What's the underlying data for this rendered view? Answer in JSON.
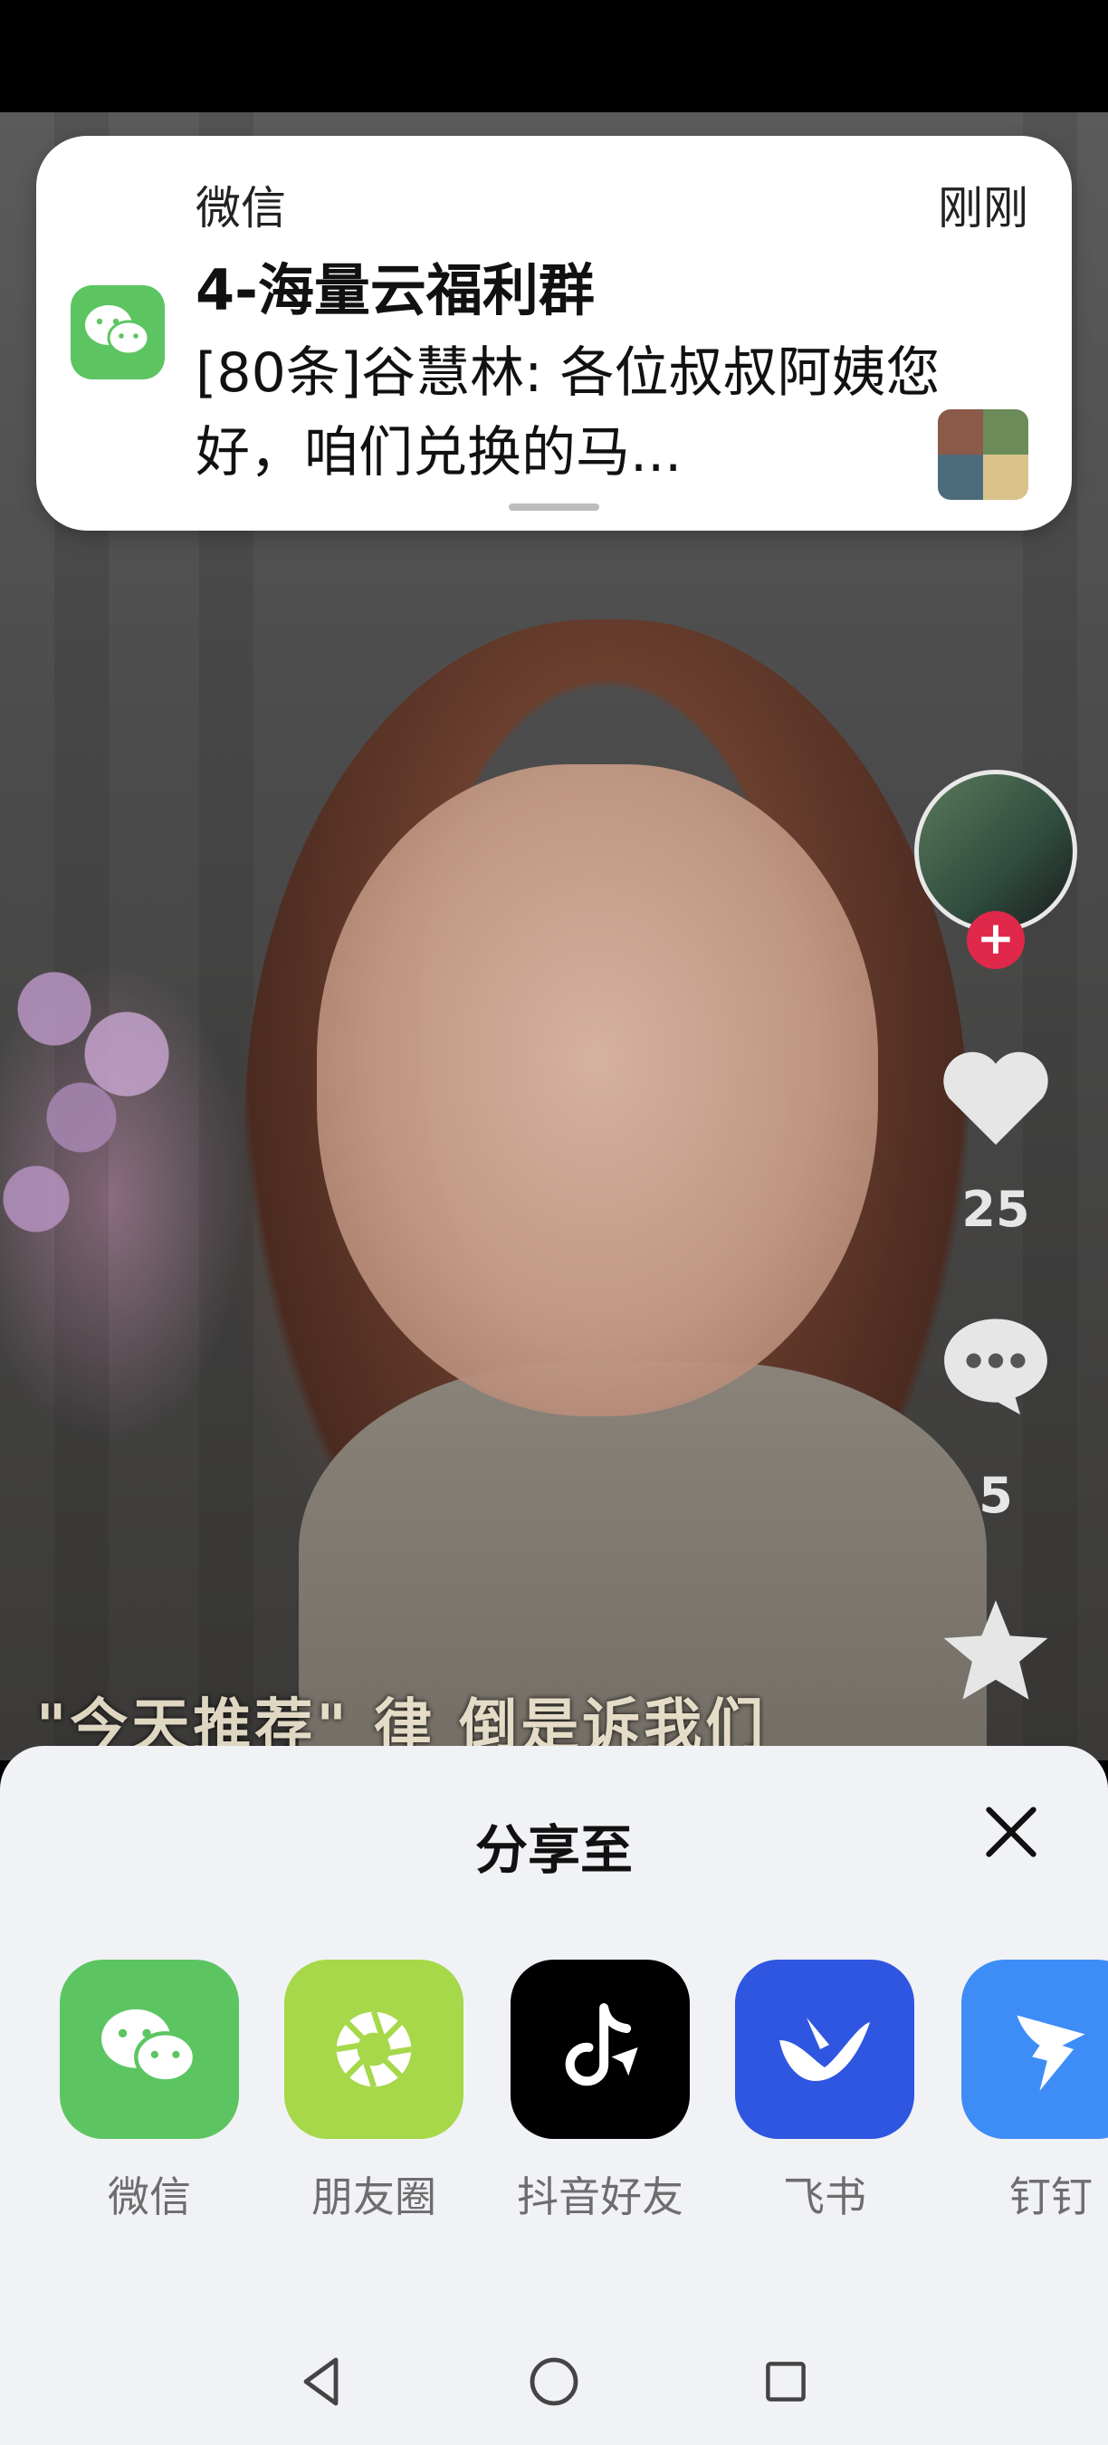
{
  "notification": {
    "app_name": "微信",
    "time": "刚刚",
    "title": "4-海量云福利群",
    "body": "[80条]谷慧林: 各位叔叔阿姨您好，咱们兑换的马...",
    "app_icon": "wechat-icon"
  },
  "video": {
    "subtitle": "\"今天推荐\" 律 倒是诉我们",
    "likes": "25",
    "comments": "5",
    "icons": [
      "avatar",
      "heart-icon",
      "comment-icon",
      "star-icon"
    ]
  },
  "share_sheet": {
    "title": "分享至",
    "close_icon": "close-icon",
    "targets": [
      {
        "label": "微信",
        "icon": "wechat-icon",
        "color": "#5cc562"
      },
      {
        "label": "朋友圈",
        "icon": "moments-icon",
        "color": "#a6d84a"
      },
      {
        "label": "抖音好友",
        "icon": "douyin-icon",
        "color": "#000000"
      },
      {
        "label": "飞书",
        "icon": "feishu-icon",
        "color": "#2f56e0"
      },
      {
        "label": "钉钉",
        "icon": "dingtalk-icon",
        "color": "#3e8df7"
      }
    ]
  },
  "nav": {
    "icons": [
      "back-icon",
      "home-icon",
      "recents-icon"
    ]
  }
}
